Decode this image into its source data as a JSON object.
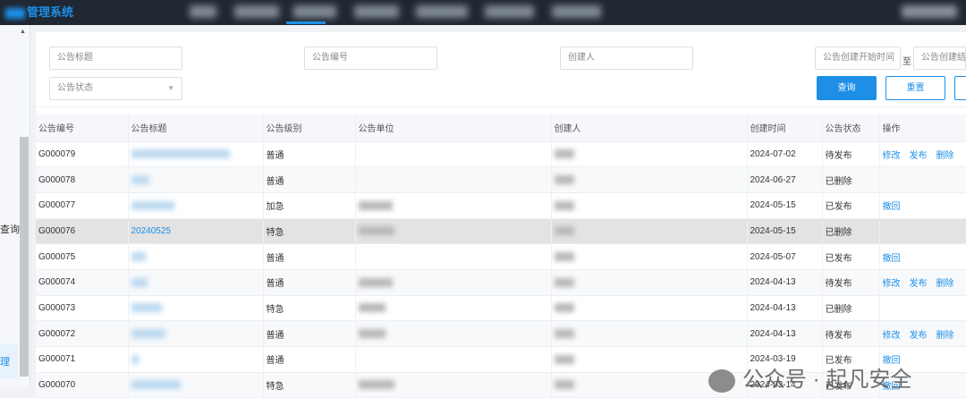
{
  "app": {
    "title": "管理系统"
  },
  "sidebar": {
    "items": [
      {
        "label": "查询"
      },
      {
        "label": "理"
      }
    ]
  },
  "search": {
    "title_placeholder": "公告标题",
    "number_placeholder": "公告编号",
    "creator_placeholder": "创建人",
    "start_placeholder": "公告创建开始时间",
    "range_sep": "至",
    "end_placeholder": "公告创建结",
    "status_placeholder": "公告状态",
    "query_label": "查询",
    "reset_label": "重置"
  },
  "table": {
    "headers": [
      "公告编号",
      "公告标题",
      "公告级别",
      "公告单位",
      "创建人",
      "创建时间",
      "公告状态",
      "操作"
    ],
    "rows": [
      {
        "id": "G000079",
        "title": "",
        "level": "普通",
        "date": "2024-07-02",
        "status": "待发布",
        "actions": [
          "修改",
          "发布",
          "删除"
        ]
      },
      {
        "id": "G000078",
        "title": "",
        "level": "普通",
        "date": "2024-06-27",
        "status": "已删除",
        "actions": []
      },
      {
        "id": "G000077",
        "title": "",
        "level": "加急",
        "date": "2024-05-15",
        "status": "已发布",
        "actions": [
          "撤回"
        ]
      },
      {
        "id": "G000076",
        "title": "20240525",
        "level": "特急",
        "date": "2024-05-15",
        "status": "已删除",
        "actions": []
      },
      {
        "id": "G000075",
        "title": "",
        "level": "普通",
        "date": "2024-05-07",
        "status": "已发布",
        "actions": [
          "撤回"
        ]
      },
      {
        "id": "G000074",
        "title": "",
        "level": "普通",
        "date": "2024-04-13",
        "status": "待发布",
        "actions": [
          "修改",
          "发布",
          "删除"
        ]
      },
      {
        "id": "G000073",
        "title": "",
        "level": "特急",
        "date": "2024-04-13",
        "status": "已删除",
        "actions": []
      },
      {
        "id": "G000072",
        "title": "",
        "level": "普通",
        "date": "2024-04-13",
        "status": "待发布",
        "actions": [
          "修改",
          "发布",
          "删除"
        ]
      },
      {
        "id": "G000071",
        "title": "",
        "level": "普通",
        "date": "2024-03-19",
        "status": "已发布",
        "actions": [
          "撤回"
        ]
      },
      {
        "id": "G000070",
        "title": "",
        "level": "特急",
        "date": "2024-03-14",
        "status": "已发布",
        "actions": [
          "撤回"
        ]
      }
    ]
  },
  "watermark": {
    "text": "公众号 · 起凡安全"
  }
}
